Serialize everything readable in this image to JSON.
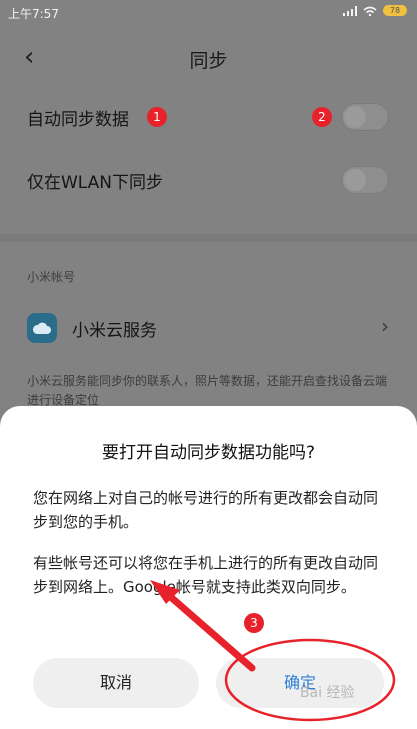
{
  "status_bar": {
    "time": "上午7:57",
    "battery": "78"
  },
  "header": {
    "back_icon": "‹",
    "title": "同步"
  },
  "settings": {
    "auto_sync_label": "自动同步数据",
    "wlan_only_label": "仅在WLAN下同步"
  },
  "badges": {
    "one": "1",
    "two": "2",
    "three": "3"
  },
  "account_section": {
    "label": "小米帐号",
    "cloud_service_label": "小米云服务",
    "description": "小米云服务能同步你的联系人，照片等数据，还能开启查找设备云端进行设备定位"
  },
  "dialog": {
    "title": "要打开自动同步数据功能吗?",
    "paragraph1": "您在网络上对自己的帐号进行的所有更改都会自动同步到您的手机。",
    "paragraph2": "有些帐号还可以将您在手机上进行的所有更改自动同步到网络上。Google帐号就支持此类双向同步。",
    "cancel_label": "取消",
    "ok_label": "确定"
  },
  "watermark": "Bai 经验",
  "colors": {
    "accent": "#2f7fd6",
    "annotation_red": "#e8222a"
  }
}
